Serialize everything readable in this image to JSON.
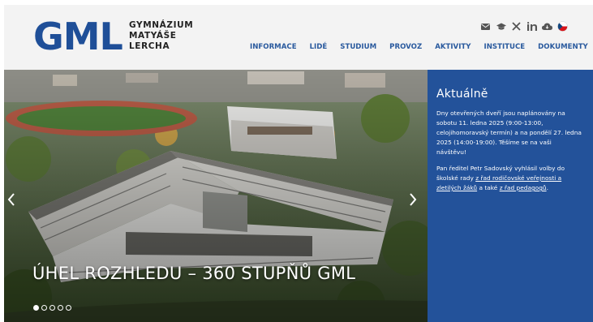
{
  "header": {
    "logo_mark": "GML",
    "logo_lines": [
      "GYMNÁZIUM",
      "MATYÁŠE",
      "LERCHA"
    ],
    "icons": [
      "email-icon",
      "graduation-cap-icon",
      "x-icon",
      "linkedin-icon",
      "cloud-icon",
      "czech-flag-icon"
    ],
    "nav": [
      "INFORMACE",
      "LIDÉ",
      "STUDIUM",
      "PROVOZ",
      "AKTIVITY",
      "INSTITUCE",
      "DOKUMENTY"
    ]
  },
  "hero": {
    "caption": "ÚHEL ROZHLEDU – 360 STUPŇŮ GML",
    "prev_label": "‹",
    "next_label": "›",
    "slide_count": 5,
    "active_slide": 1
  },
  "news": {
    "title": "Aktuálně",
    "item1": "Dny otevřených dveří jsou naplánovány na sobotu 11. ledna 2025 (9:00-13:00, celojihomoravský termín) a na pondělí 27. ledna 2025 (14:00-19:00). Těšíme se na vaši návštěvu!",
    "item2_prefix": "Pan ředitel Petr Sadovský vyhlásil volby do školské rady ",
    "item2_link1": "z řad rodičovské veřejnosti a zletilých žáků",
    "item2_middle": " a také ",
    "item2_link2": "z řad pedagogů",
    "item2_suffix": "."
  },
  "colors": {
    "brand_blue": "#1f4f98",
    "panel_blue": "#23529a",
    "nav_blue": "#2a5a9e",
    "header_bg": "#f3f3f3",
    "flag_red": "#d7141a"
  }
}
